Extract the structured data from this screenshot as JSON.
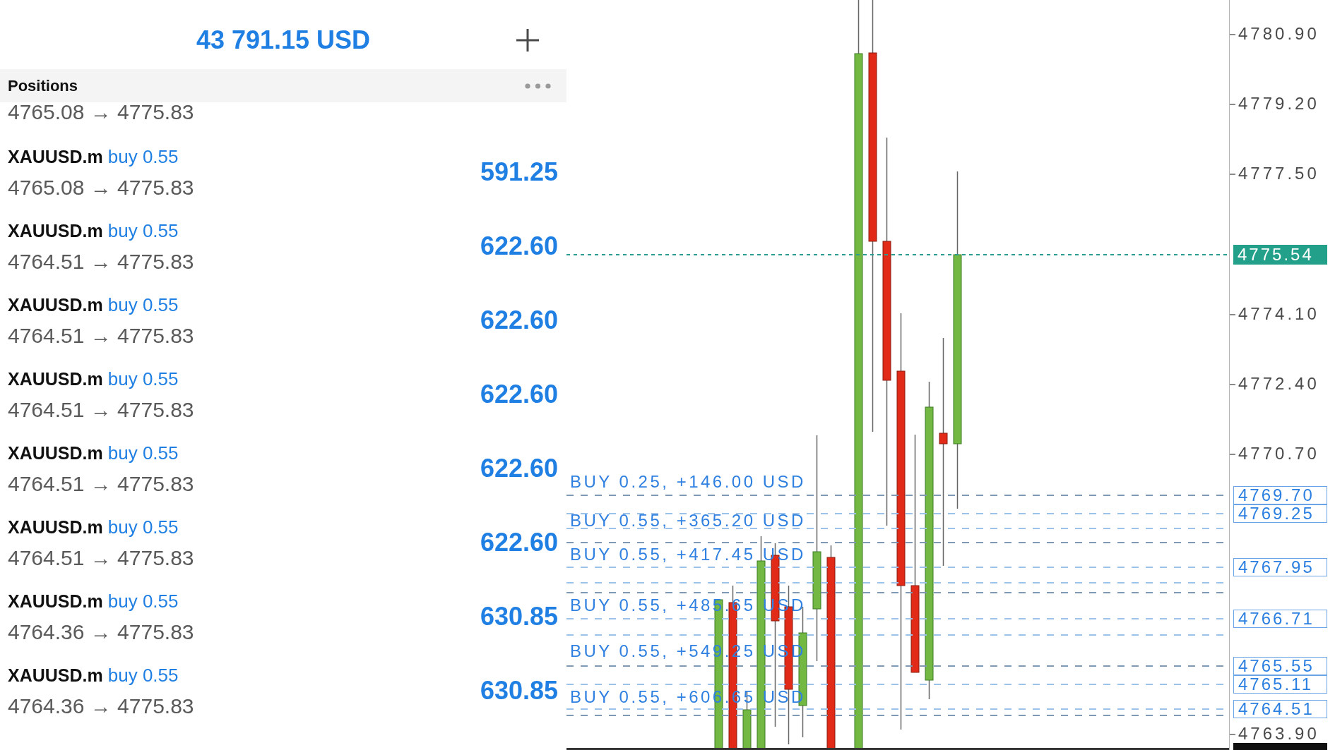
{
  "header": {
    "balance": "43 791.15 USD"
  },
  "positions": {
    "title": "Positions",
    "items": [
      {
        "prices": "4765.08 → 4775.83"
      },
      {
        "symbol": "XAUUSD.m",
        "side": "buy 0.55",
        "prices": "4765.08 → 4775.83",
        "profit": "591.25"
      },
      {
        "symbol": "XAUUSD.m",
        "side": "buy 0.55",
        "prices": "4764.51 → 4775.83",
        "profit": "622.60"
      },
      {
        "symbol": "XAUUSD.m",
        "side": "buy 0.55",
        "prices": "4764.51 → 4775.83",
        "profit": "622.60"
      },
      {
        "symbol": "XAUUSD.m",
        "side": "buy 0.55",
        "prices": "4764.51 → 4775.83",
        "profit": "622.60"
      },
      {
        "symbol": "XAUUSD.m",
        "side": "buy 0.55",
        "prices": "4764.51 → 4775.83",
        "profit": "622.60"
      },
      {
        "symbol": "XAUUSD.m",
        "side": "buy 0.55",
        "prices": "4764.51 → 4775.83",
        "profit": "622.60"
      },
      {
        "symbol": "XAUUSD.m",
        "side": "buy 0.55",
        "prices": "4764.36 → 4775.83",
        "profit": "630.85"
      },
      {
        "symbol": "XAUUSD.m",
        "side": "buy 0.55",
        "prices": "4764.36 → 4775.83",
        "profit": "630.85"
      }
    ]
  },
  "chart": {
    "order_labels": [
      "BUY 0.25, +146.00 USD",
      "BUY 0.55, +365.20 USD",
      "BUY 0.55, +417.45 USD",
      "BUY 0.55, +485.65 USD",
      "BUY 0.55, +549.25 USD",
      "BUY 0.55, +606.65 USD"
    ],
    "price_axis": {
      "ticks": [
        "4780.90",
        "4779.20",
        "4777.50",
        "4774.10",
        "4772.40",
        "4770.70",
        "4763.90"
      ],
      "order_tags": [
        "4769.70",
        "4769.25",
        "4767.95",
        "4766.71",
        "4765.55",
        "4765.11",
        "4764.51"
      ],
      "current_price": "4775.54"
    }
  }
}
